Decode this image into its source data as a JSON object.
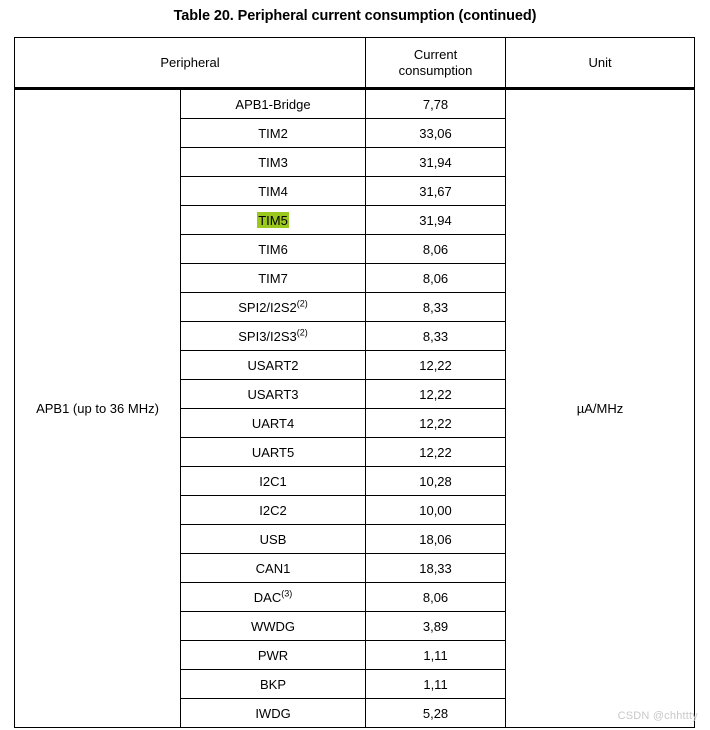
{
  "document": {
    "caption": "Table 20. Peripheral current consumption (continued)",
    "watermark": "CSDN @chhttty"
  },
  "table": {
    "headers": {
      "peripheral": "Peripheral",
      "current_consumption": "Current\nconsumption",
      "current_consumption_line1": "Current",
      "current_consumption_line2": "consumption",
      "unit": "Unit"
    },
    "group_label": "APB1 (up to 36 MHz)",
    "unit_value": "µA/MHz",
    "highlight_color": "#9ac81e",
    "rows": [
      {
        "name": "APB1-Bridge",
        "note": "",
        "value": "7,78",
        "highlighted": false
      },
      {
        "name": "TIM2",
        "note": "",
        "value": "33,06",
        "highlighted": false
      },
      {
        "name": "TIM3",
        "note": "",
        "value": "31,94",
        "highlighted": false
      },
      {
        "name": "TIM4",
        "note": "",
        "value": "31,67",
        "highlighted": false
      },
      {
        "name": "TIM5",
        "note": "",
        "value": "31,94",
        "highlighted": true
      },
      {
        "name": "TIM6",
        "note": "",
        "value": "8,06",
        "highlighted": false
      },
      {
        "name": "TIM7",
        "note": "",
        "value": "8,06",
        "highlighted": false
      },
      {
        "name": "SPI2/I2S2",
        "note": "(2)",
        "value": "8,33",
        "highlighted": false
      },
      {
        "name": "SPI3/I2S3",
        "note": "(2)",
        "value": "8,33",
        "highlighted": false
      },
      {
        "name": "USART2",
        "note": "",
        "value": "12,22",
        "highlighted": false
      },
      {
        "name": "USART3",
        "note": "",
        "value": "12,22",
        "highlighted": false
      },
      {
        "name": "UART4",
        "note": "",
        "value": "12,22",
        "highlighted": false
      },
      {
        "name": "UART5",
        "note": "",
        "value": "12,22",
        "highlighted": false
      },
      {
        "name": "I2C1",
        "note": "",
        "value": "10,28",
        "highlighted": false
      },
      {
        "name": "I2C2",
        "note": "",
        "value": "10,00",
        "highlighted": false
      },
      {
        "name": "USB",
        "note": "",
        "value": "18,06",
        "highlighted": false
      },
      {
        "name": "CAN1",
        "note": "",
        "value": "18,33",
        "highlighted": false
      },
      {
        "name": "DAC",
        "note": "(3)",
        "value": "8,06",
        "highlighted": false
      },
      {
        "name": "WWDG",
        "note": "",
        "value": "3,89",
        "highlighted": false
      },
      {
        "name": "PWR",
        "note": "",
        "value": "1,11",
        "highlighted": false
      },
      {
        "name": "BKP",
        "note": "",
        "value": "1,11",
        "highlighted": false
      },
      {
        "name": "IWDG",
        "note": "",
        "value": "5,28",
        "highlighted": false
      }
    ]
  }
}
